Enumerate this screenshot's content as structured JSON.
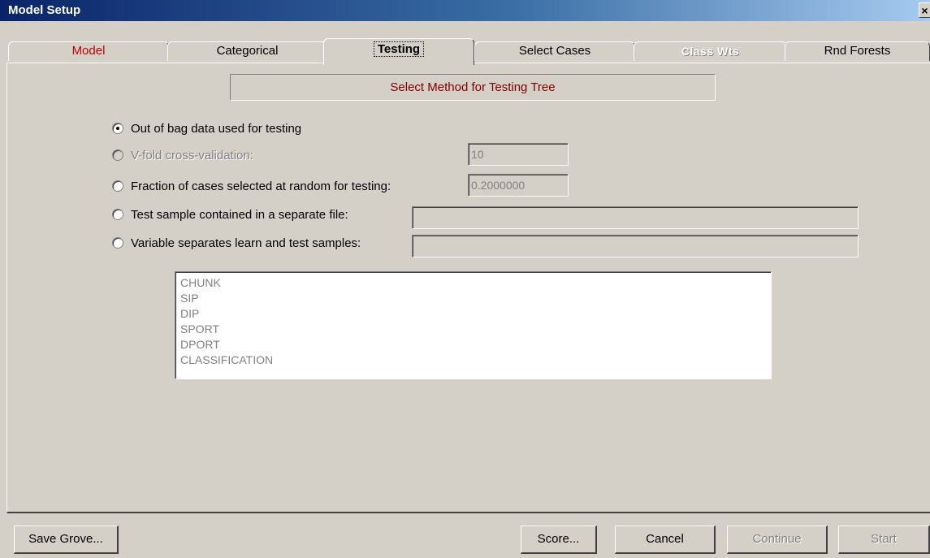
{
  "window": {
    "title": "Model Setup",
    "close_label": "×"
  },
  "tabs": [
    {
      "label": "Model"
    },
    {
      "label": "Categorical"
    },
    {
      "label": "Testing"
    },
    {
      "label": "Select Cases"
    },
    {
      "label": "Class Wts"
    },
    {
      "label": "Rnd Forests"
    }
  ],
  "active_tab": "Testing",
  "header": "Select Method for Testing Tree",
  "options": [
    {
      "label": "Out of bag data used for testing",
      "selected": true,
      "enabled": true
    },
    {
      "label": "V-fold cross-validation:",
      "selected": false,
      "enabled": false,
      "value": "10"
    },
    {
      "label": "Fraction of cases selected at random for testing:",
      "selected": false,
      "enabled": true,
      "value": "0.2000000"
    },
    {
      "label": "Test sample contained in a separate file:",
      "selected": false,
      "enabled": true,
      "value": ""
    },
    {
      "label": "Variable separates learn and test samples:",
      "selected": false,
      "enabled": true,
      "value": ""
    }
  ],
  "variables": [
    "CHUNK",
    "SIP",
    "DIP",
    "SPORT",
    "DPORT",
    "CLASSIFICATION"
  ],
  "buttons": {
    "save_grove": "Save Grove...",
    "score": "Score...",
    "cancel": "Cancel",
    "continue": "Continue",
    "start": "Start"
  },
  "colors": {
    "title_start": "#0a246a",
    "model_tab": "#c00000",
    "header_text": "#800000",
    "face": "#d4d0c8"
  }
}
